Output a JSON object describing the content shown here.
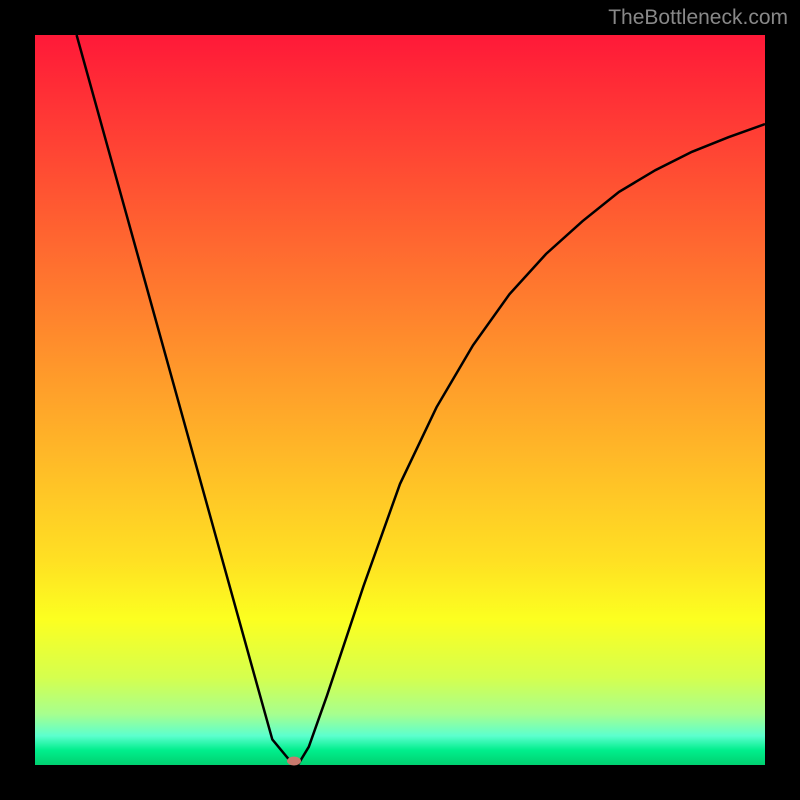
{
  "watermark": "TheBottleneck.com",
  "chart_data": {
    "type": "line",
    "title": "",
    "xlabel": "",
    "ylabel": "",
    "xlim": [
      0,
      1
    ],
    "ylim": [
      0,
      1
    ],
    "series": [
      {
        "name": "curve",
        "x": [
          0.057,
          0.1,
          0.15,
          0.2,
          0.25,
          0.3,
          0.325,
          0.35,
          0.36,
          0.375,
          0.4,
          0.45,
          0.5,
          0.55,
          0.6,
          0.65,
          0.7,
          0.75,
          0.8,
          0.85,
          0.9,
          0.95,
          1.0
        ],
        "y": [
          1.0,
          0.845,
          0.665,
          0.485,
          0.305,
          0.125,
          0.035,
          0.005,
          0.0,
          0.025,
          0.095,
          0.245,
          0.385,
          0.49,
          0.575,
          0.645,
          0.7,
          0.745,
          0.785,
          0.815,
          0.84,
          0.86,
          0.878
        ]
      }
    ],
    "marker": {
      "x": 0.355,
      "y": 0.0
    },
    "gradient_stops": [
      {
        "pos": 0.0,
        "color": "#ff1938"
      },
      {
        "pos": 0.5,
        "color": "#ff9e2a"
      },
      {
        "pos": 0.8,
        "color": "#fcff20"
      },
      {
        "pos": 1.0,
        "color": "#00d070"
      }
    ]
  }
}
